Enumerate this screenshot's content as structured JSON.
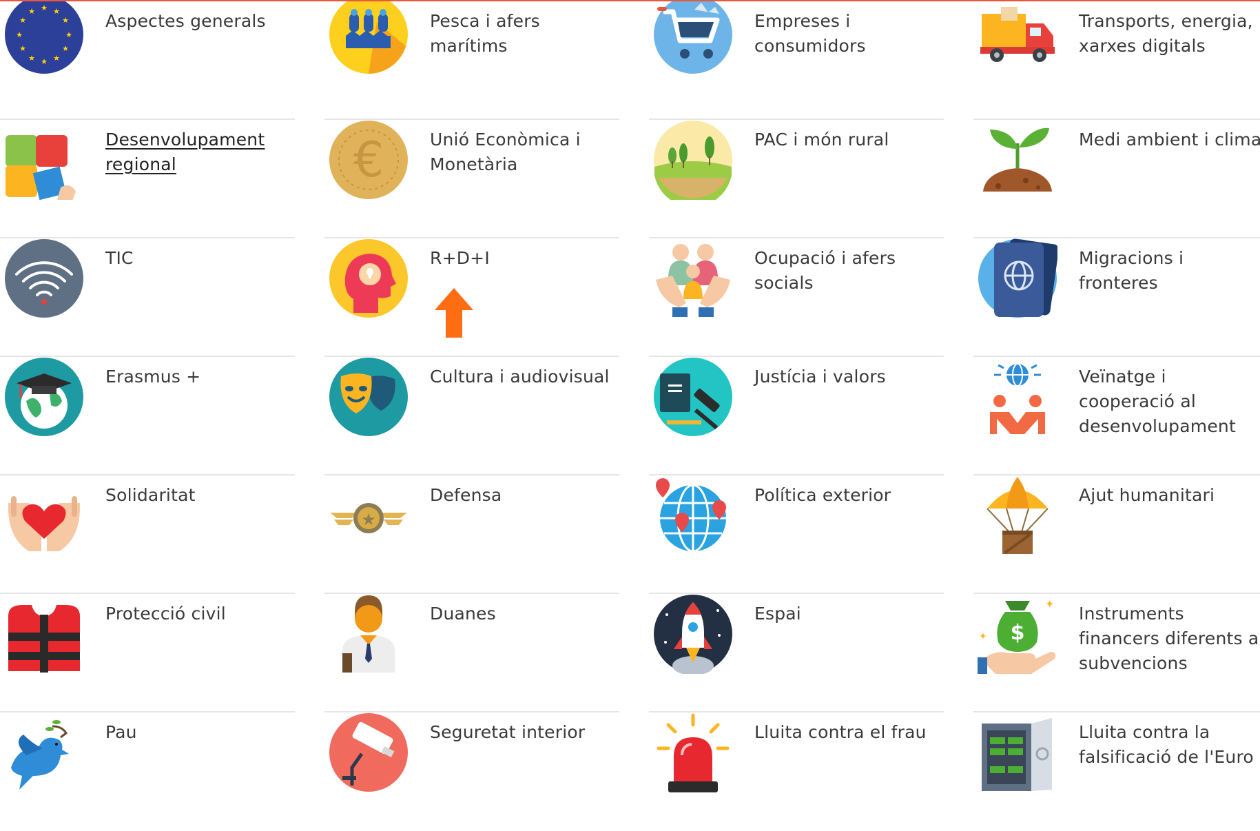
{
  "categories": [
    {
      "label": "Aspectes generals",
      "icon": "eu-flag-icon"
    },
    {
      "label": "Pesca i afers marítims",
      "icon": "fishing-icon"
    },
    {
      "label": "Empreses i consumidors",
      "icon": "shopping-cart-icon"
    },
    {
      "label": "Transports, energia, xarxes digitals",
      "icon": "delivery-truck-icon"
    },
    {
      "label": "Desenvolupament regional",
      "icon": "puzzle-icon"
    },
    {
      "label": "Unió Econòmica i Monetària",
      "icon": "euro-coin-icon"
    },
    {
      "label": "PAC i món rural",
      "icon": "rural-landscape-icon"
    },
    {
      "label": "Medi ambient i clima",
      "icon": "plant-sprout-icon"
    },
    {
      "label": "TIC",
      "icon": "wifi-icon"
    },
    {
      "label": "R+D+I",
      "icon": "innovation-head-icon"
    },
    {
      "label": "Ocupació i afers socials",
      "icon": "family-hands-icon"
    },
    {
      "label": "Migracions i fronteres",
      "icon": "passport-icon"
    },
    {
      "label": "Erasmus +",
      "icon": "graduation-globe-icon"
    },
    {
      "label": "Cultura i audiovisual",
      "icon": "theater-masks-icon"
    },
    {
      "label": "Justícia i valors",
      "icon": "gavel-book-icon"
    },
    {
      "label": "Veïnatge i cooperació al desenvolupament",
      "icon": "cooperation-globe-icon"
    },
    {
      "label": "Solidaritat",
      "icon": "heart-hands-icon"
    },
    {
      "label": "Defensa",
      "icon": "military-badge-icon"
    },
    {
      "label": "Política exterior",
      "icon": "globe-pins-icon"
    },
    {
      "label": "Ajut humanitari",
      "icon": "parachute-aid-icon"
    },
    {
      "label": "Protecció civil",
      "icon": "life-vest-icon"
    },
    {
      "label": "Duanes",
      "icon": "customs-officer-icon"
    },
    {
      "label": "Espai",
      "icon": "rocket-icon"
    },
    {
      "label": "Instruments financers diferents a subvencions",
      "icon": "money-bag-hand-icon"
    },
    {
      "label": "Pau",
      "icon": "peace-dove-icon"
    },
    {
      "label": "Seguretat interior",
      "icon": "security-camera-icon"
    },
    {
      "label": "Lluita contra el frau",
      "icon": "alarm-siren-icon"
    },
    {
      "label": "Lluita contra la falsificació de l'Euro",
      "icon": "safe-vault-icon"
    }
  ],
  "colors": {
    "top_border": "#e8573f",
    "divider": "#e6e6e6",
    "text": "#3a3a3a"
  }
}
